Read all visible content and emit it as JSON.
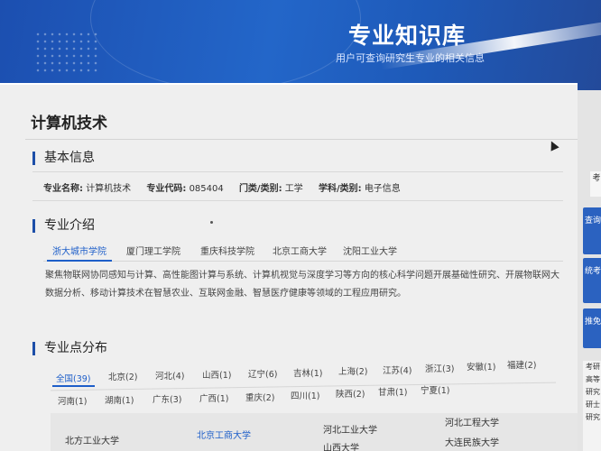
{
  "banner": {
    "title": "专业知识库",
    "subtitle": "用户可查询研究生专业的相关信息"
  },
  "page_title": "计算机技术",
  "basic_info": {
    "heading": "基本信息",
    "fields": [
      {
        "key": "专业名称:",
        "value": "计算机技术"
      },
      {
        "key": "专业代码:",
        "value": "085404"
      },
      {
        "key": "门类/类别:",
        "value": "工学"
      },
      {
        "key": "学科/类别:",
        "value": "电子信息"
      }
    ]
  },
  "intro": {
    "heading": "专业介绍",
    "tabs": [
      "浙大城市学院",
      "厦门理工学院",
      "重庆科技学院",
      "北京工商大学",
      "沈阳工业大学"
    ],
    "active_tab": 0,
    "text": "聚焦物联网协同感知与计算、高性能图计算与系统、计算机视觉与深度学习等方向的核心科学问题开展基础性研究、开展物联网大数据分析、移动计算技术在智慧农业、互联网金融、智慧医疗健康等领域的工程应用研究。"
  },
  "distribution": {
    "heading": "专业点分布",
    "regions_row1": [
      "全国(39)",
      "北京(2)",
      "河北(4)",
      "山西(1)",
      "辽宁(6)",
      "吉林(1)",
      "上海(2)",
      "江苏(4)",
      "浙江(3)",
      "安徽(1)",
      "福建(2)"
    ],
    "regions_row2": [
      "河南(1)",
      "湖南(1)",
      "广东(3)",
      "广西(1)",
      "重庆(2)",
      "四川(1)",
      "陕西(2)",
      "甘肃(1)",
      "宁夏(1)"
    ],
    "universities": [
      "北方工业大学",
      "北京工商大学",
      "河北工业大学",
      "河北工程大学",
      "山西大学",
      "大连民族大学"
    ]
  },
  "sidebar": {
    "top_label": "考",
    "buttons": [
      "查询",
      "统考",
      "推免"
    ],
    "panel_items": [
      "考研",
      "高等",
      "研究",
      "研士",
      "研究"
    ]
  }
}
